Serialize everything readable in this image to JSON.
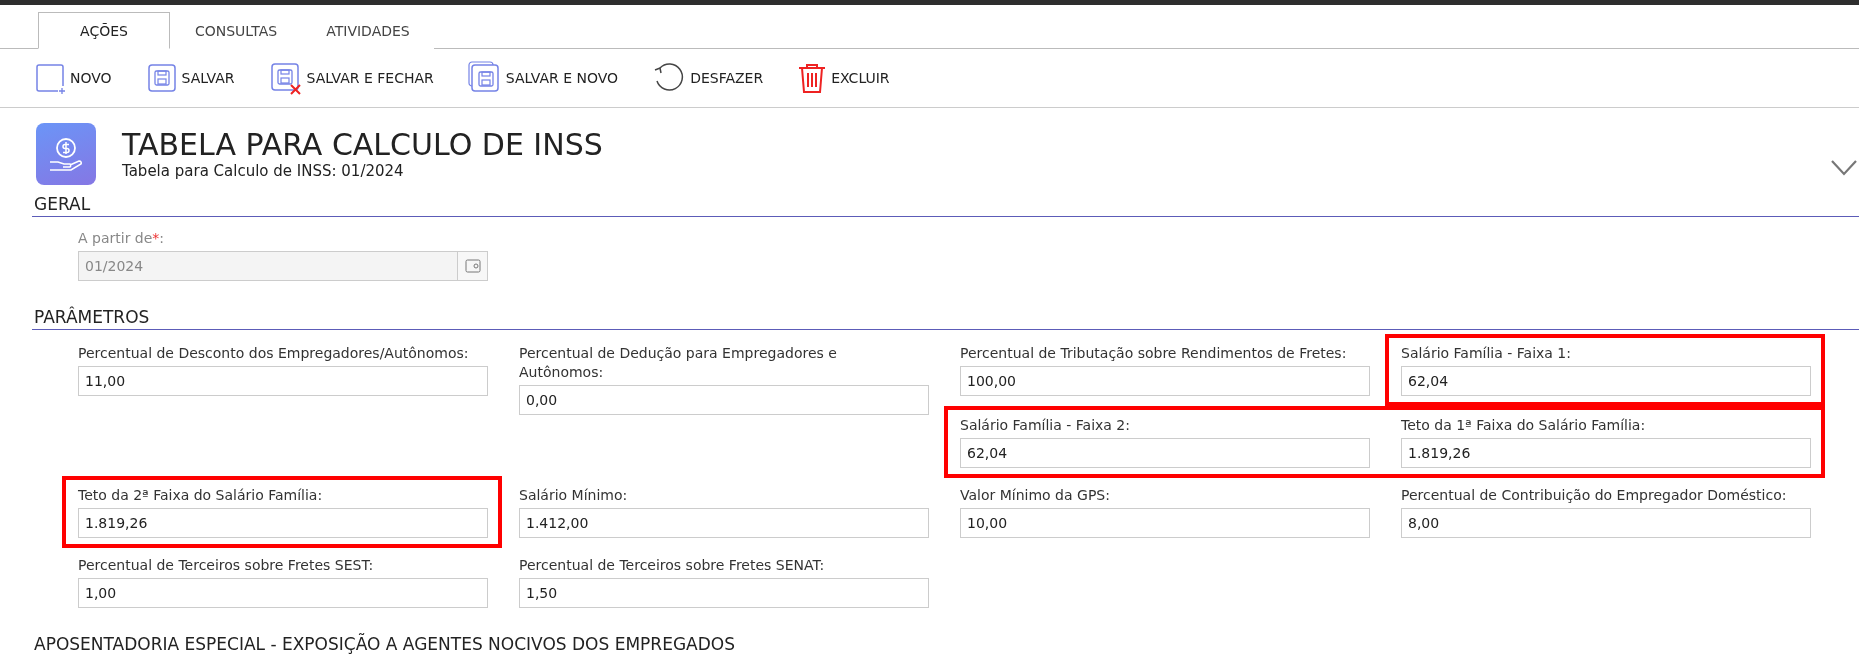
{
  "tabs": [
    {
      "label": "AÇÕES",
      "selected": true
    },
    {
      "label": "CONSULTAS",
      "selected": false
    },
    {
      "label": "ATIVIDADES",
      "selected": false
    }
  ],
  "toolbar": [
    {
      "label": "NOVO",
      "kind": "new"
    },
    {
      "label": "SALVAR",
      "kind": "save"
    },
    {
      "label": "SALVAR E FECHAR",
      "kind": "save_close"
    },
    {
      "label": "SALVAR E NOVO",
      "kind": "save_new"
    },
    {
      "label": "DESFAZER",
      "kind": "undo"
    },
    {
      "label": "EXCLUIR",
      "kind": "delete"
    }
  ],
  "header": {
    "title": "TABELA PARA CALCULO DE INSS",
    "subtitle": "Tabela para Calculo de INSS: 01/2024"
  },
  "geral": {
    "heading": "GERAL",
    "field": {
      "label": "A partir de",
      "required": true,
      "required_mark": "*",
      "label_end": ":",
      "value": "01/2024",
      "disabled": true
    }
  },
  "parametros": {
    "heading": "PARÂMETROS",
    "fields": [
      {
        "label": "Percentual de Desconto dos Empregadores/Autônomos:",
        "value": "11,00",
        "highlighted": false
      },
      {
        "label": "Percentual de Dedução para Empregadores e Autônomos:",
        "value": "0,00",
        "highlighted": false
      },
      {
        "label": "Percentual de Tributação sobre Rendimentos de Fretes:",
        "value": "100,00",
        "highlighted": false
      },
      {
        "label": "Salário Família - Faixa 1:",
        "value": "62,04",
        "highlighted": true
      },
      {
        "label": "Salário Família - Faixa 2:",
        "value": "62,04",
        "highlighted": true
      },
      {
        "label": "Teto da 1ª Faixa do Salário Família:",
        "value": "1.819,26",
        "highlighted": true
      },
      {
        "label": "Teto da 2ª Faixa do Salário Família:",
        "value": "1.819,26",
        "highlighted": true
      },
      {
        "label": "Salário Mínimo:",
        "value": "1.412,00",
        "highlighted": false
      },
      {
        "label": "Valor Mínimo da GPS:",
        "value": "10,00",
        "highlighted": false
      },
      {
        "label": "Percentual de Contribuição do Empregador Doméstico:",
        "value": "8,00",
        "highlighted": false
      },
      {
        "label": "Percentual de Terceiros sobre Fretes SEST:",
        "value": "1,00",
        "highlighted": false
      },
      {
        "label": "Percentual de Terceiros sobre Fretes SENAT:",
        "value": "1,50",
        "highlighted": false
      }
    ]
  },
  "aposentadoria": {
    "heading": "APOSENTADORIA ESPECIAL - EXPOSIÇÃO A AGENTES NOCIVOS DOS EMPREGADOS"
  }
}
